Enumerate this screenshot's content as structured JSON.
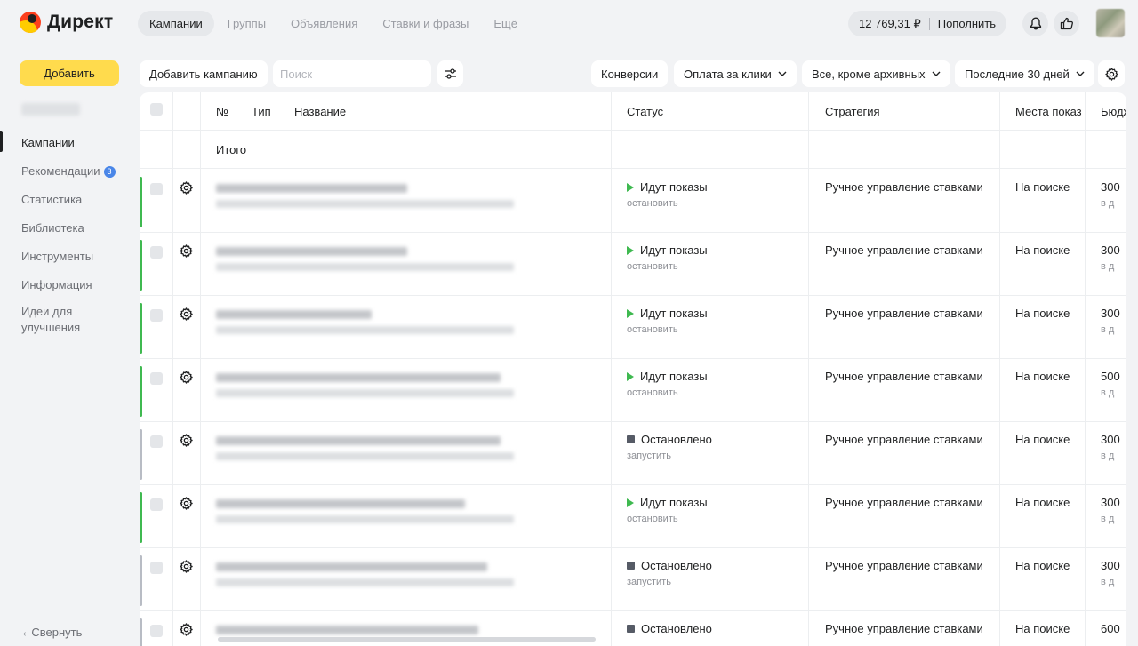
{
  "header": {
    "logo_text": "Директ",
    "tabs": [
      {
        "label": "Кампании",
        "active": true
      },
      {
        "label": "Группы",
        "active": false
      },
      {
        "label": "Объявления",
        "active": false
      },
      {
        "label": "Ставки и фразы",
        "active": false
      },
      {
        "label": "Ещё",
        "active": false
      }
    ],
    "balance": "12 769,31 ₽",
    "topup_label": "Пополнить",
    "icons": [
      "bell-icon",
      "thumbs-up-icon"
    ]
  },
  "sidebar": {
    "add_label": "Добавить",
    "items": [
      {
        "label": "Кампании",
        "active": true
      },
      {
        "label": "Рекомендации",
        "badge": "3"
      },
      {
        "label": "Статистика"
      },
      {
        "label": "Библиотека"
      },
      {
        "label": "Инструменты"
      },
      {
        "label": "Информация"
      },
      {
        "label": "Идеи для улучшения"
      }
    ],
    "collapse_label": "Свернуть"
  },
  "toolbar": {
    "add_campaign_label": "Добавить кампанию",
    "search_placeholder": "Поиск",
    "conversions_label": "Конверсии",
    "payment_label": "Оплата за клики",
    "filter_label": "Все, кроме архивных",
    "period_label": "Последние 30 дней"
  },
  "table": {
    "columns": {
      "num": "№",
      "type": "Тип",
      "name": "Название",
      "status": "Статус",
      "strategy": "Стратегия",
      "places": "Места показ",
      "budget": "Бюдж"
    },
    "total_label": "Итого",
    "rows": [
      {
        "state": "active",
        "status": "Идут показы",
        "action": "остановить",
        "strategy": "Ручное управление ставками",
        "places": "На поиске",
        "budget": "300",
        "budget_sub": "в д"
      },
      {
        "state": "active",
        "status": "Идут показы",
        "action": "остановить",
        "strategy": "Ручное управление ставками",
        "places": "На поиске",
        "budget": "300",
        "budget_sub": "в д"
      },
      {
        "state": "active",
        "status": "Идут показы",
        "action": "остановить",
        "strategy": "Ручное управление ставками",
        "places": "На поиске",
        "budget": "300",
        "budget_sub": "в д"
      },
      {
        "state": "active",
        "status": "Идут показы",
        "action": "остановить",
        "strategy": "Ручное управление ставками",
        "places": "На поиске",
        "budget": "500",
        "budget_sub": "в д"
      },
      {
        "state": "stopped",
        "status": "Остановлено",
        "action": "запустить",
        "strategy": "Ручное управление ставками",
        "places": "На поиске",
        "budget": "300",
        "budget_sub": "в д"
      },
      {
        "state": "active",
        "status": "Идут показы",
        "action": "остановить",
        "strategy": "Ручное управление ставками",
        "places": "На поиске",
        "budget": "300",
        "budget_sub": "в д"
      },
      {
        "state": "stopped",
        "status": "Остановлено",
        "action": "запустить",
        "strategy": "Ручное управление ставками",
        "places": "На поиске",
        "budget": "300",
        "budget_sub": "в д"
      },
      {
        "state": "stopped",
        "status": "Остановлено",
        "action": "",
        "strategy": "Ручное управление ставками",
        "places": "На поиске",
        "budget": "600",
        "budget_sub": ""
      }
    ]
  },
  "colors": {
    "accent": "#ffdb4d",
    "active_marker": "#3fb950",
    "stopped_marker": "#b8bcc4",
    "badge": "#4a86e8"
  }
}
